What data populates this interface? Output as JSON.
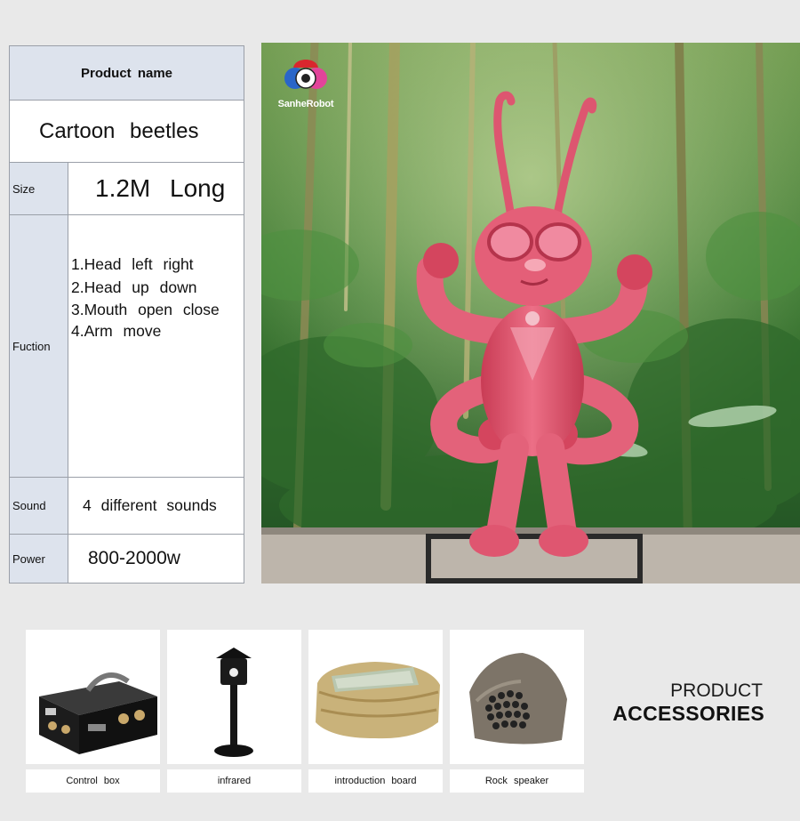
{
  "table": {
    "header": "Product name",
    "product_name": "Cartoon beetles",
    "rows": {
      "size": {
        "label": "Size",
        "value": "1.2M Long"
      },
      "function": {
        "label": "Fuction",
        "items": [
          "1.Head left right",
          "2.Head up down",
          "3.Mouth open close",
          "4.Arm move"
        ]
      },
      "sound": {
        "label": "Sound",
        "value": "4 different sounds"
      },
      "power": {
        "label": "Power",
        "value": "800-2000w"
      }
    }
  },
  "photo": {
    "logo_text": "SanheRobot",
    "subject": "pink animatronic cartoon beetle in forest",
    "colors": {
      "beetle": "#e2566e",
      "forest": "#3f7a35"
    }
  },
  "accessories": {
    "title_line1": "PRODUCT",
    "title_line2": "ACCESSORIES",
    "items": [
      {
        "label": "Control box",
        "icon": "control-box-icon"
      },
      {
        "label": "infrared",
        "icon": "infrared-sensor-icon"
      },
      {
        "label": "introduction board",
        "icon": "rock-board-icon"
      },
      {
        "label": "Rock speaker",
        "icon": "rock-speaker-icon"
      }
    ]
  }
}
